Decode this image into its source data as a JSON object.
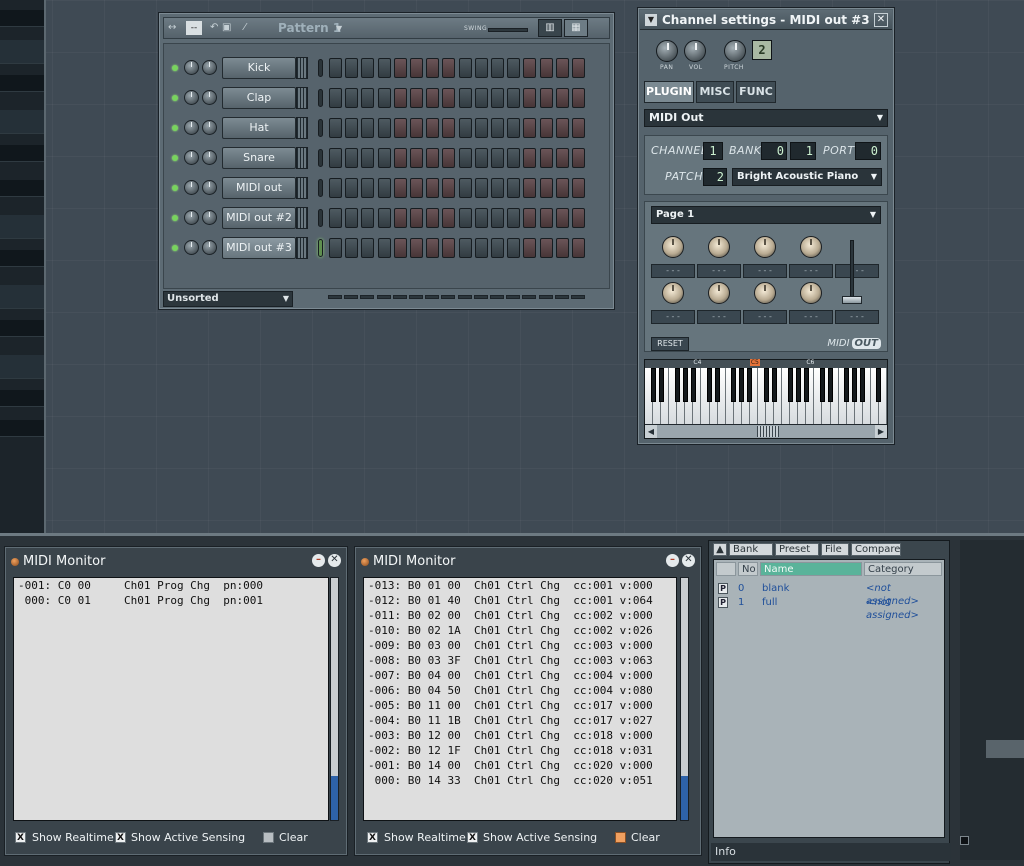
{
  "sequencer": {
    "pattern_title": "Pattern 1",
    "pattern_box": "--",
    "swing_label": "SWING",
    "filter_selected": "Unsorted",
    "channels": [
      {
        "name": "Kick"
      },
      {
        "name": "Clap"
      },
      {
        "name": "Hat"
      },
      {
        "name": "Snare"
      },
      {
        "name": "MIDI out"
      },
      {
        "name": "MIDI out #2"
      },
      {
        "name": "MIDI out #3"
      }
    ],
    "selected_channel_index": 6,
    "steps_per_channel": 16,
    "step_color_pattern": [
      "dark",
      "dark",
      "dark",
      "dark",
      "red",
      "red",
      "red",
      "red",
      "dark",
      "dark",
      "dark",
      "dark",
      "red",
      "red",
      "red",
      "red"
    ]
  },
  "channel_settings": {
    "title": "Channel settings - MIDI out #3",
    "knob_labels": {
      "pan": "PAN",
      "vol": "VOL",
      "pitch": "PITCH"
    },
    "pitch_range": "2",
    "tabs": [
      "PLUGIN",
      "MISC",
      "FUNC"
    ],
    "active_tab": "PLUGIN",
    "plugin_name": "MIDI Out",
    "channel_label": "CHANNEL",
    "channel_value": "1",
    "bank_label": "BANK",
    "bank_value_a": "0",
    "bank_value_b": "1",
    "port_label": "PORT",
    "port_value": "0",
    "patch_label": "PATCH",
    "patch_value": "2",
    "patch_name": "Bright Acoustic Piano",
    "page_selected": "Page 1",
    "knob_value_text": "- - -",
    "reset_label": "RESET",
    "logo_text": "MIDI",
    "logo_badge": "OUT",
    "piano_markers": [
      "C4",
      "C5",
      "C6"
    ],
    "piano_hot_marker": "C5",
    "colors": {
      "accent": "#e4733a",
      "knob": "#f4ead6"
    }
  },
  "midi_monitor_1": {
    "title": "MIDI Monitor",
    "lines": [
      "-001: C0 00     Ch01 Prog Chg  pn:000",
      " 000: C0 01     Ch01 Prog Chg  pn:001"
    ],
    "show_realtime": "Show Realtime",
    "show_realtime_checked": "X",
    "show_active_sensing": "Show Active Sensing",
    "show_active_sensing_checked": "X",
    "clear": "Clear"
  },
  "midi_monitor_2": {
    "title": "MIDI Monitor",
    "lines": [
      "-013: B0 01 00  Ch01 Ctrl Chg  cc:001 v:000",
      "-012: B0 01 40  Ch01 Ctrl Chg  cc:001 v:064",
      "-011: B0 02 00  Ch01 Ctrl Chg  cc:002 v:000",
      "-010: B0 02 1A  Ch01 Ctrl Chg  cc:002 v:026",
      "-009: B0 03 00  Ch01 Ctrl Chg  cc:003 v:000",
      "-008: B0 03 3F  Ch01 Ctrl Chg  cc:003 v:063",
      "-007: B0 04 00  Ch01 Ctrl Chg  cc:004 v:000",
      "-006: B0 04 50  Ch01 Ctrl Chg  cc:004 v:080",
      "-005: B0 11 00  Ch01 Ctrl Chg  cc:017 v:000",
      "-004: B0 11 1B  Ch01 Ctrl Chg  cc:017 v:027",
      "-003: B0 12 00  Ch01 Ctrl Chg  cc:018 v:000",
      "-002: B0 12 1F  Ch01 Ctrl Chg  cc:018 v:031",
      "-001: B0 14 00  Ch01 Ctrl Chg  cc:020 v:000",
      " 000: B0 14 33  Ch01 Ctrl Chg  cc:020 v:051"
    ],
    "show_realtime": "Show Realtime",
    "show_realtime_checked": "X",
    "show_active_sensing": "Show Active Sensing",
    "show_active_sensing_checked": "X",
    "clear": "Clear"
  },
  "preset_browser": {
    "tabs": [
      "Bank",
      "Preset",
      "File",
      "Compare"
    ],
    "columns": {
      "no": "No",
      "name": "Name",
      "category": "Category"
    },
    "rows": [
      {
        "p": "P",
        "no": "0",
        "name": "blank",
        "category": "<not assigned>"
      },
      {
        "p": "P",
        "no": "1",
        "name": "full",
        "category": "<not assigned>"
      }
    ],
    "info": "Info"
  }
}
